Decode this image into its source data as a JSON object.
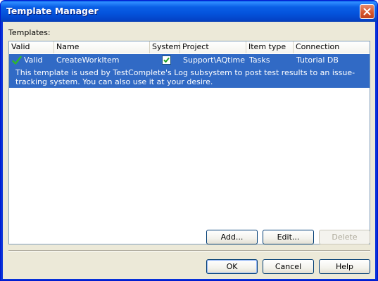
{
  "window": {
    "title": "Template Manager"
  },
  "templates_label": "Templates:",
  "grid": {
    "columns": [
      "Valid",
      "Name",
      "System",
      "Project",
      "Item type",
      "Connection"
    ],
    "rows": [
      {
        "valid": "Valid",
        "name": "CreateWorkItem",
        "system_checked": true,
        "project": "Support\\AQtime",
        "item_type": "Tasks",
        "connection": "Tutorial DB",
        "description": "This template is used by TestComplete's Log subsystem to post test results to an issue-tracking system. You can also use it at your desire."
      }
    ]
  },
  "buttons": {
    "add": "Add...",
    "edit": "Edit...",
    "delete": "Delete",
    "ok": "OK",
    "cancel": "Cancel",
    "help": "Help"
  },
  "colors": {
    "selection": "#316ac5",
    "title_bar": "#0a5fe6",
    "face": "#ece9d8"
  }
}
